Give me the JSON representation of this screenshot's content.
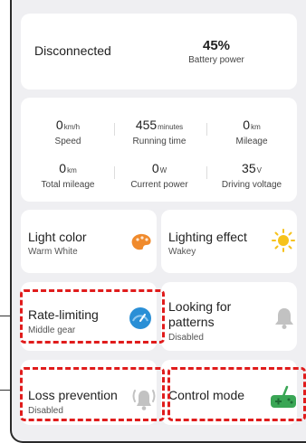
{
  "status": {
    "connection": "Disconnected",
    "battery_value": "45%",
    "battery_label": "Battery power"
  },
  "stats": [
    {
      "value": "0",
      "unit": "km/h",
      "label": "Speed"
    },
    {
      "value": "455",
      "unit": "minutes",
      "label": "Running time"
    },
    {
      "value": "0",
      "unit": "km",
      "label": "Mileage"
    },
    {
      "value": "0",
      "unit": "km",
      "label": "Total mileage"
    },
    {
      "value": "0",
      "unit": "W",
      "label": "Current power"
    },
    {
      "value": "35",
      "unit": "V",
      "label": "Driving voltage"
    }
  ],
  "tiles": {
    "light_color": {
      "title": "Light color",
      "sub": "Warm White",
      "icon": "palette-icon"
    },
    "lighting_effect": {
      "title": "Lighting effect",
      "sub": "Wakey",
      "icon": "sun-icon"
    },
    "rate_limiting": {
      "title": "Rate-limiting",
      "sub": "Middle gear",
      "icon": "speedometer-icon"
    },
    "looking_patterns": {
      "title1": "Looking for",
      "title2": "patterns",
      "sub": "Disabled",
      "icon": "bell-icon"
    },
    "loss_prevention": {
      "title": "Loss prevention",
      "sub": "Disabled",
      "icon": "alarm-icon"
    },
    "control_mode": {
      "title": "Control mode",
      "icon": "gamepad-icon"
    }
  },
  "colors": {
    "highlight": "#e01c1c",
    "palette": "#f08a2c",
    "sun": "#f6c21b",
    "speedometer": "#2a8fd6",
    "gamepad": "#3aa655",
    "bell": "#c2c2c2"
  }
}
